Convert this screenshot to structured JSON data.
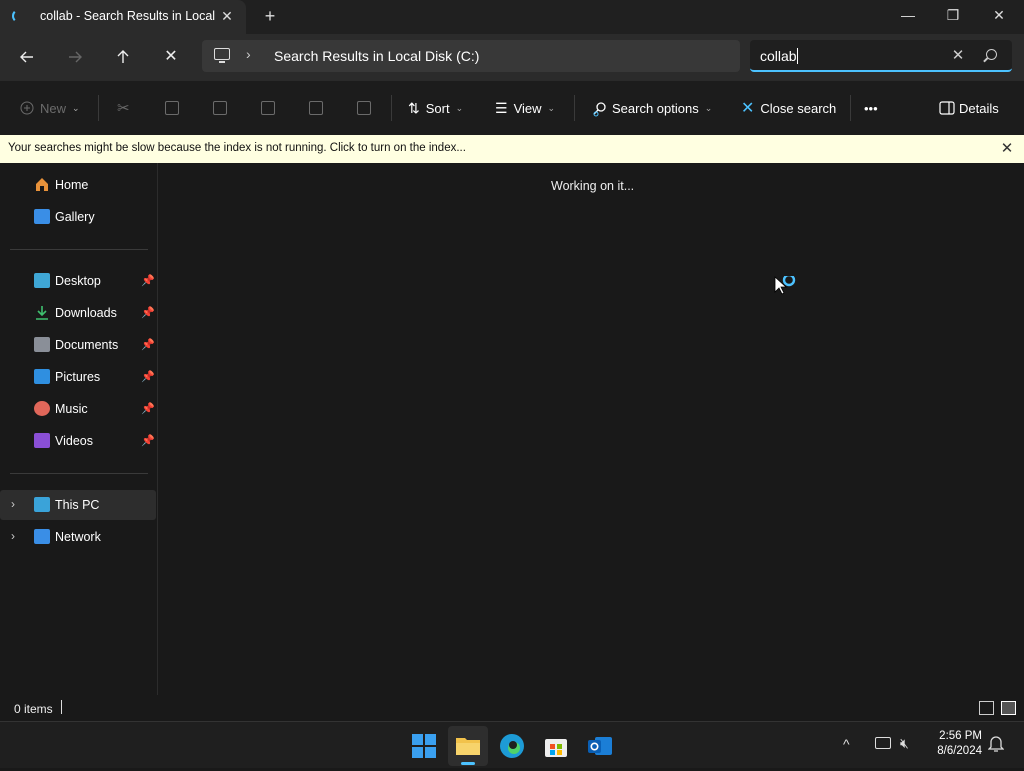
{
  "window": {
    "tab_title": "collab - Search Results in Local",
    "new_tab_label": "+",
    "close_tab_label": "✕",
    "minimize_label": "—",
    "maximize_label": "❐",
    "close_label": "✕"
  },
  "nav": {
    "back_icon": "back-arrow-icon",
    "forward_icon": "forward-arrow-icon",
    "up_icon": "up-arrow-icon",
    "stop_label": "✕",
    "address_text": "Search Results in Local Disk (C:)",
    "address_chevron": "›",
    "search_value": "collab",
    "search_clear_label": "✕"
  },
  "toolbar": {
    "new_label": "New",
    "sort_label": "Sort",
    "view_label": "View",
    "search_options_label": "Search options",
    "close_search_label": "Close search",
    "more_label": "•••",
    "details_label": "Details"
  },
  "banner": {
    "text": "Your searches might be slow because the index is not running.  Click to turn on the index...",
    "close_label": "✕"
  },
  "sidebar": {
    "items": [
      {
        "label": "Home",
        "icon": "home-icon"
      },
      {
        "label": "Gallery",
        "icon": "gallery-icon"
      },
      {
        "label": "Desktop",
        "icon": "desktop-icon",
        "pinned": true
      },
      {
        "label": "Downloads",
        "icon": "downloads-icon",
        "pinned": true
      },
      {
        "label": "Documents",
        "icon": "documents-icon",
        "pinned": true
      },
      {
        "label": "Pictures",
        "icon": "pictures-icon",
        "pinned": true
      },
      {
        "label": "Music",
        "icon": "music-icon",
        "pinned": true
      },
      {
        "label": "Videos",
        "icon": "videos-icon",
        "pinned": true
      },
      {
        "label": "This PC",
        "icon": "this-pc-icon",
        "selected": true
      },
      {
        "label": "Network",
        "icon": "network-icon"
      }
    ],
    "pin_glyph": "📌",
    "expand_glyph": "›"
  },
  "main": {
    "status_message": "Working on it..."
  },
  "statusbar": {
    "items_count": "0 items"
  },
  "taskbar": {
    "apps": [
      "start-icon",
      "file-explorer-icon",
      "edge-icon",
      "store-icon",
      "outlook-icon"
    ],
    "time": "2:56 PM",
    "date": "8/6/2024",
    "tray_chevron": "^"
  },
  "colors": {
    "accent": "#4cc2ff",
    "banner_bg": "#ffffe1",
    "window_bg": "#191919"
  }
}
